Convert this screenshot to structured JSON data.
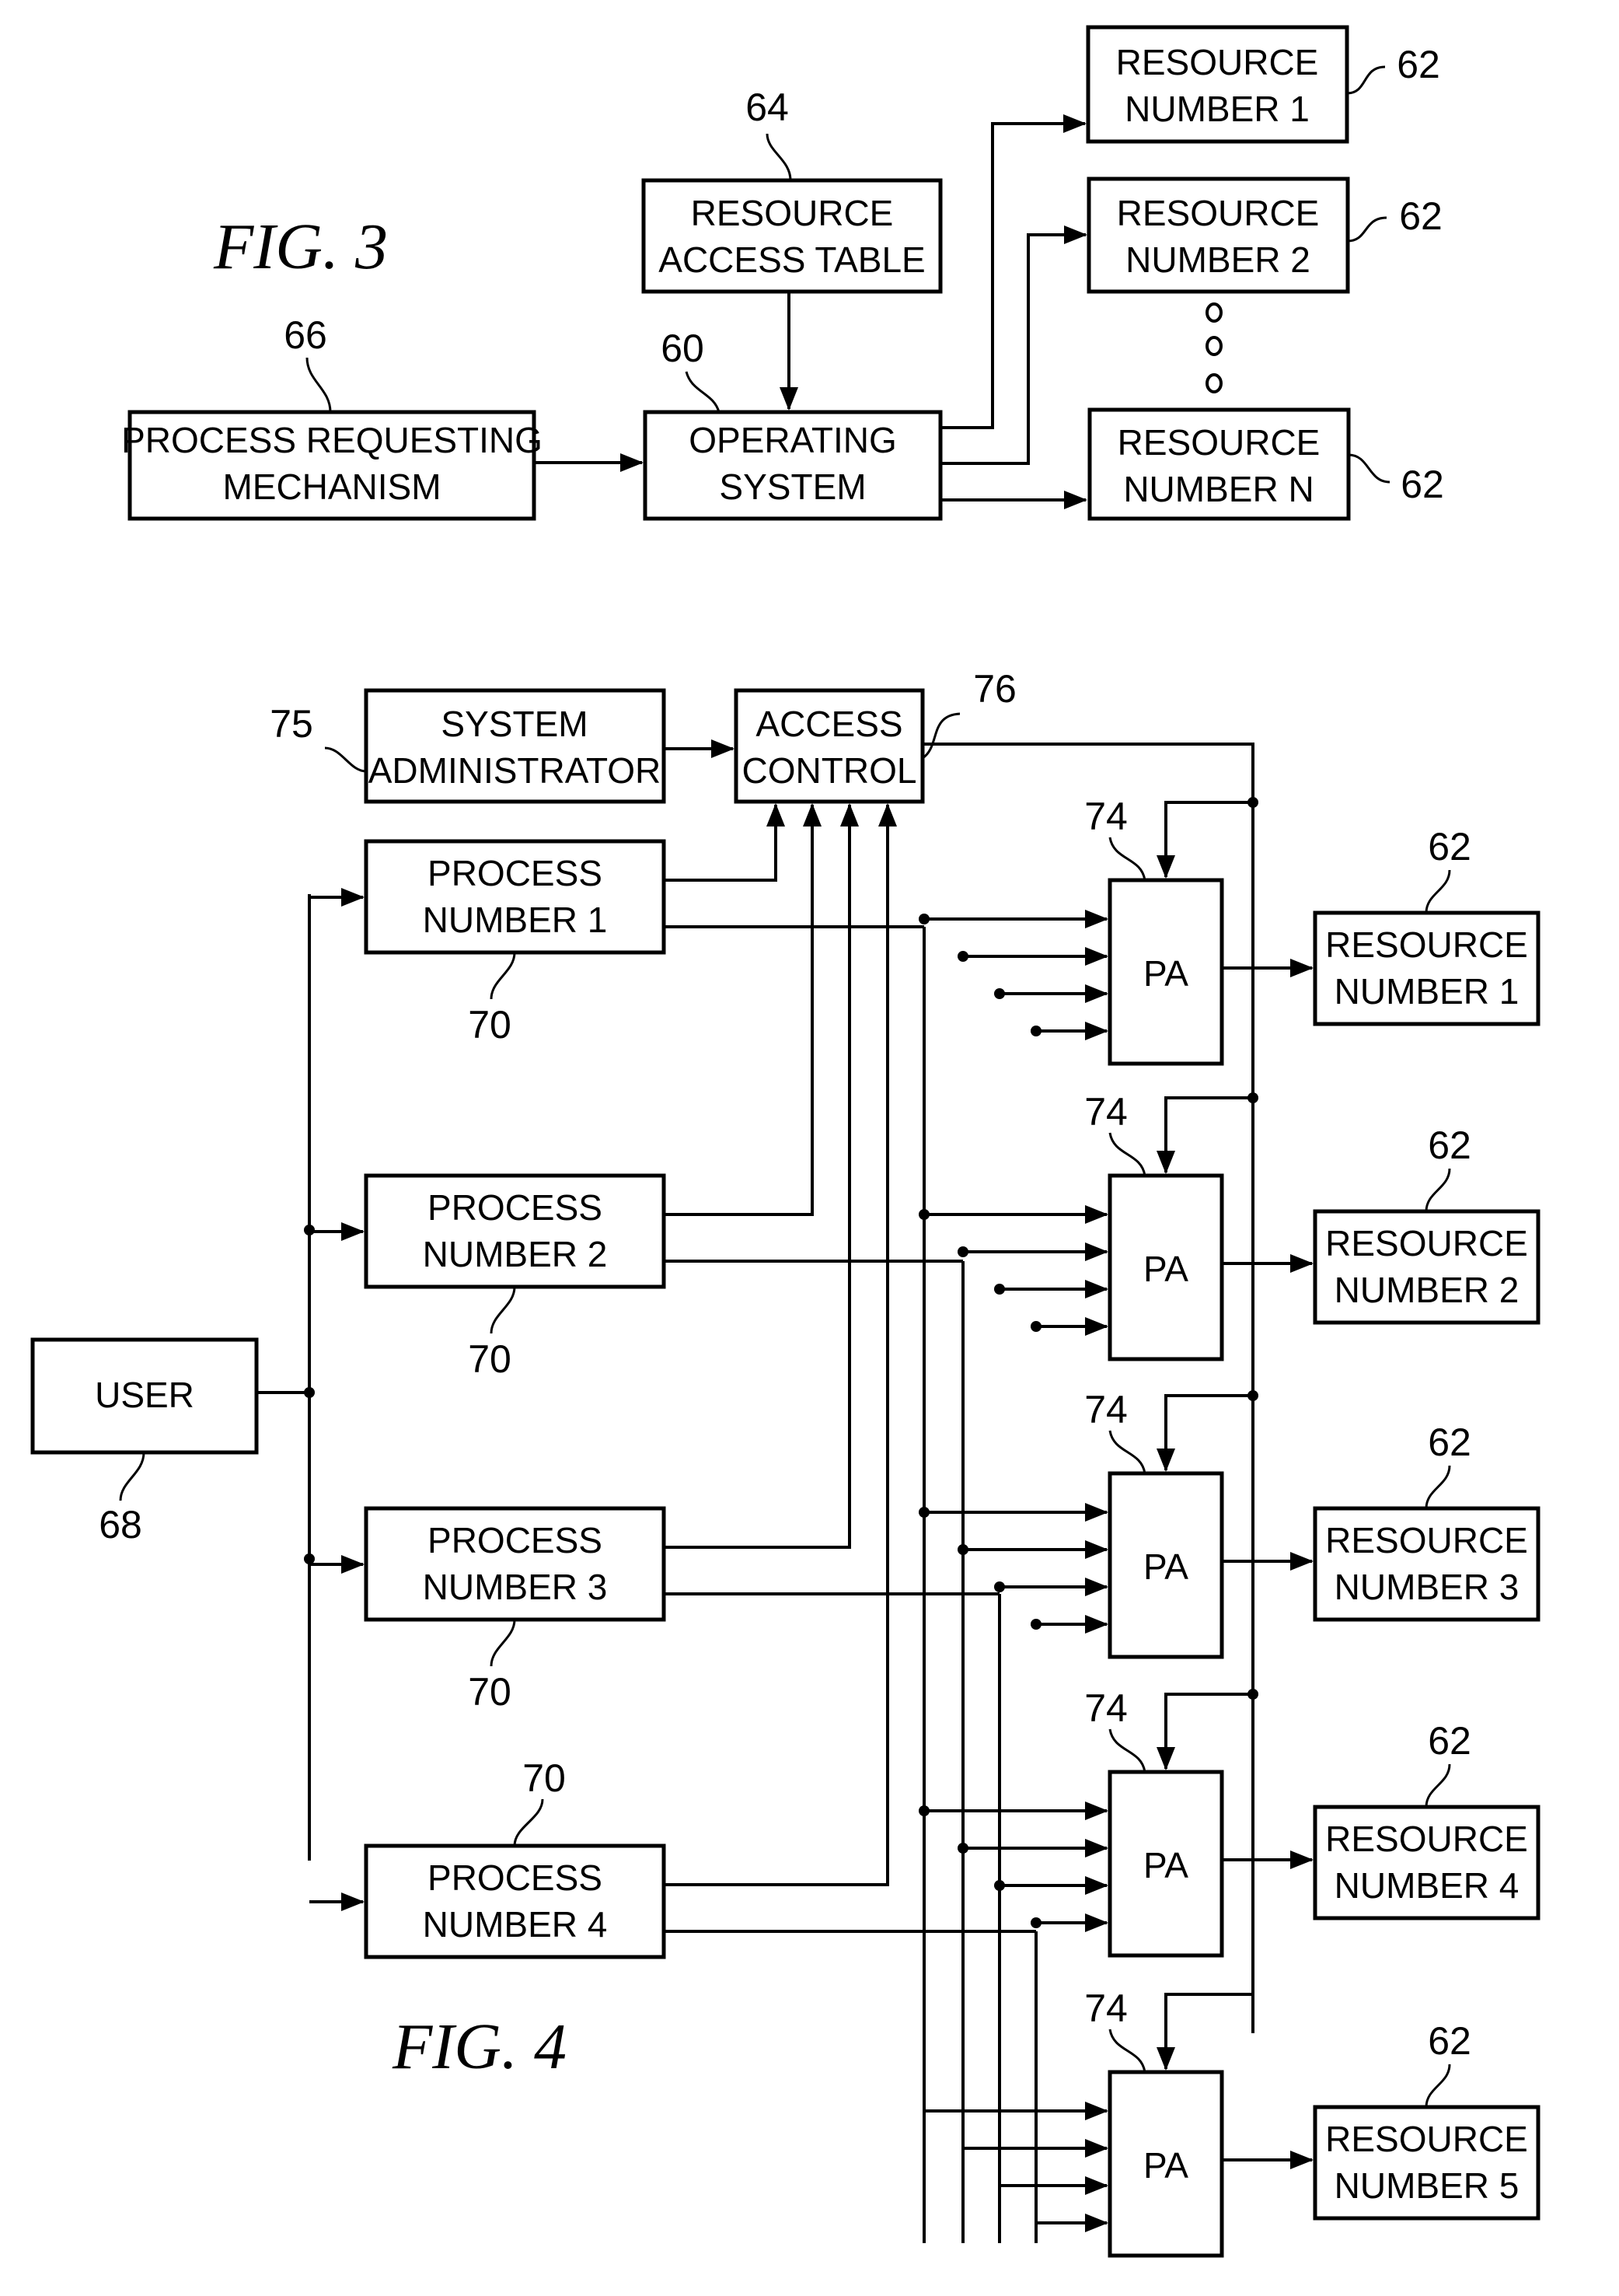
{
  "figure3": {
    "label": "FIG. 3",
    "blocks": {
      "process_requesting": {
        "line1": "PROCESS REQUESTING",
        "line2": "MECHANISM",
        "ref": "66"
      },
      "operating_system": {
        "line1": "OPERATING",
        "line2": "SYSTEM",
        "ref": "60"
      },
      "resource_access_table": {
        "line1": "RESOURCE",
        "line2": "ACCESS TABLE",
        "ref": "64"
      },
      "resources": [
        {
          "line1": "RESOURCE",
          "line2": "NUMBER 1",
          "ref": "62"
        },
        {
          "line1": "RESOURCE",
          "line2": "NUMBER 2",
          "ref": "62"
        },
        {
          "line1": "RESOURCE",
          "line2": "NUMBER N",
          "ref": "62"
        }
      ]
    }
  },
  "figure4": {
    "label": "FIG. 4",
    "system_administrator": {
      "line1": "SYSTEM",
      "line2": "ADMINISTRATOR",
      "ref": "75"
    },
    "access_control": {
      "line1": "ACCESS",
      "line2": "CONTROL",
      "ref": "76"
    },
    "user": {
      "line1": "USER",
      "ref": "68"
    },
    "processes": [
      {
        "line1": "PROCESS",
        "line2": "NUMBER 1",
        "ref": "70"
      },
      {
        "line1": "PROCESS",
        "line2": "NUMBER 2",
        "ref": "70"
      },
      {
        "line1": "PROCESS",
        "line2": "NUMBER 3",
        "ref": "70"
      },
      {
        "line1": "PROCESS",
        "line2": "NUMBER 4",
        "ref": "70"
      }
    ],
    "pa_blocks": [
      {
        "label": "PA",
        "ref": "74"
      },
      {
        "label": "PA",
        "ref": "74"
      },
      {
        "label": "PA",
        "ref": "74"
      },
      {
        "label": "PA",
        "ref": "74"
      },
      {
        "label": "PA",
        "ref": "74"
      }
    ],
    "resources": [
      {
        "line1": "RESOURCE",
        "line2": "NUMBER 1",
        "ref": "62"
      },
      {
        "line1": "RESOURCE",
        "line2": "NUMBER 2",
        "ref": "62"
      },
      {
        "line1": "RESOURCE",
        "line2": "NUMBER 3",
        "ref": "62"
      },
      {
        "line1": "RESOURCE",
        "line2": "NUMBER 4",
        "ref": "62"
      },
      {
        "line1": "RESOURCE",
        "line2": "NUMBER 5",
        "ref": "62"
      }
    ]
  }
}
